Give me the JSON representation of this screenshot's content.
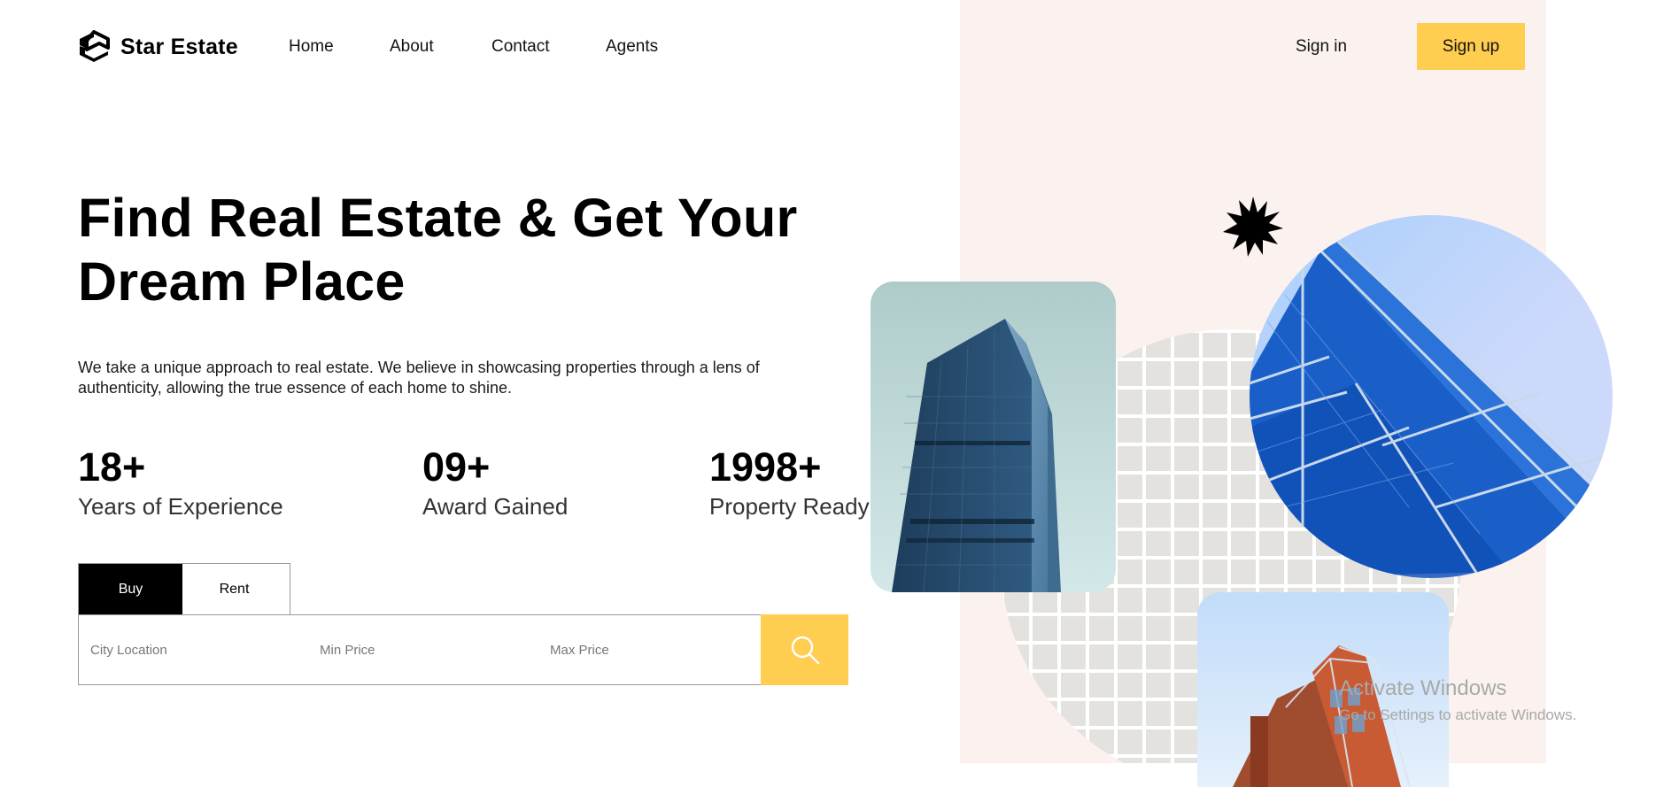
{
  "brand": {
    "name": "Star Estate",
    "logo_icon": "star-estate-logo-icon"
  },
  "nav": {
    "items": [
      {
        "label": "Home"
      },
      {
        "label": "About"
      },
      {
        "label": "Contact"
      },
      {
        "label": "Agents"
      }
    ]
  },
  "auth": {
    "sign_in": "Sign in",
    "sign_up": "Sign up"
  },
  "hero": {
    "headline_line1": "Find Real Estate & Get Your",
    "headline_line2": "Dream Place",
    "description_line1": "We take a unique approach to real estate. We believe in showcasing properties through a lens of",
    "description_line2": "authenticity, allowing the true essence of each home to shine."
  },
  "stats": [
    {
      "value": "18+",
      "label": "Years of Experience"
    },
    {
      "value": "09+",
      "label": "Award Gained"
    },
    {
      "value": "1998+",
      "label": "Property Ready"
    }
  ],
  "search": {
    "tabs": [
      {
        "label": "Buy",
        "active": true
      },
      {
        "label": "Rent",
        "active": false
      }
    ],
    "city_placeholder": "City Location",
    "min_price_placeholder": "Min Price",
    "max_price_placeholder": "Max Price",
    "button_icon": "search-icon"
  },
  "watermark": {
    "title": "Activate Windows",
    "subtitle": "Go to Settings to activate Windows."
  },
  "colors": {
    "accent": "#ffcd4f",
    "panel_background": "#fbf2f0",
    "active_tab": "#000000"
  }
}
